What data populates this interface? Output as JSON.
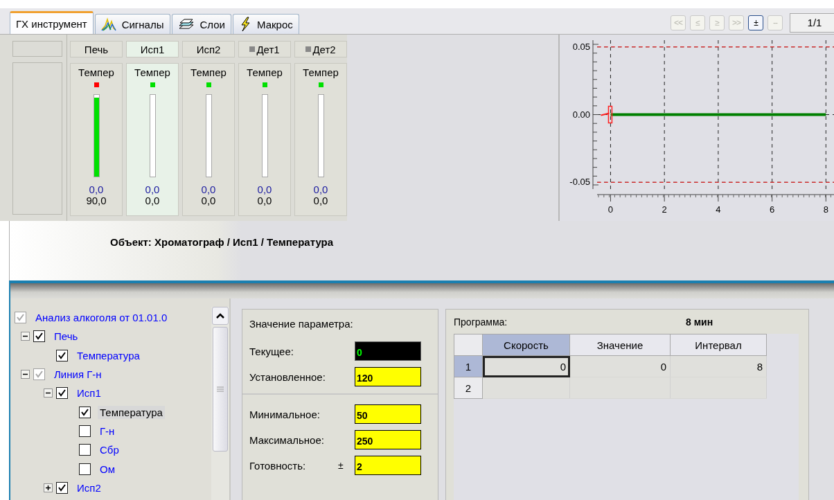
{
  "tabs": [
    {
      "label": "ГХ инструмент",
      "kind": "plain",
      "selected": true
    },
    {
      "label": "Сигналы",
      "kind": "signals",
      "selected": false
    },
    {
      "label": "Слои",
      "kind": "layers",
      "selected": false
    },
    {
      "label": "Макрос",
      "kind": "macro",
      "selected": false
    }
  ],
  "nav_buttons": [
    {
      "label": "<<",
      "disabled": true
    },
    {
      "label": "≤",
      "disabled": true
    },
    {
      "label": "≥",
      "disabled": true
    },
    {
      "label": ">>",
      "disabled": true
    },
    {
      "label": "±",
      "disabled": false
    },
    {
      "label": "--",
      "disabled": true
    }
  ],
  "page_indicator": "1/1",
  "channels": [
    {
      "name": "Печь",
      "marker": false,
      "selected": false,
      "parameter": "Темпер",
      "color": "#ff0000",
      "level": 0.97,
      "reading": "0,0",
      "setpoint": "90,0"
    },
    {
      "name": "Исп1",
      "marker": false,
      "selected": true,
      "parameter": "Темпер",
      "color": "#00e000",
      "level": 0,
      "reading": "0,0",
      "setpoint": "0,0"
    },
    {
      "name": "Исп2",
      "marker": false,
      "selected": false,
      "parameter": "Темпер",
      "color": "#00e000",
      "level": 0,
      "reading": "0,0",
      "setpoint": "0,0"
    },
    {
      "name": "Дет1",
      "marker": true,
      "selected": false,
      "parameter": "Темпер",
      "color": "#00e000",
      "level": 0,
      "reading": "0,0",
      "setpoint": "0,0"
    },
    {
      "name": "Дет2",
      "marker": true,
      "selected": false,
      "parameter": "Темпер",
      "color": "#00e000",
      "level": 0,
      "reading": "0,0",
      "setpoint": "0,0"
    }
  ],
  "chart": {
    "chart_data": {
      "type": "line",
      "grid": true,
      "x": [
        0,
        8
      ],
      "series": [
        {
          "color": "#008000",
          "values": [
            0,
            0
          ]
        }
      ],
      "xlim": [
        -0.5,
        8.3
      ],
      "ylim": [
        -0.055,
        0.055
      ],
      "xticks": [
        0,
        2,
        4,
        6,
        8
      ],
      "yticks": [
        {
          "value": 0.05,
          "label": "0.05"
        },
        {
          "value": 0,
          "label": "0.00"
        },
        {
          "value": -0.05,
          "label": "-0.05"
        }
      ]
    }
  },
  "object_path": "Объект: Хроматограф / Исп1 / Температура",
  "tree": [
    {
      "label": "Анализ алкоголя от 01.01.0",
      "checked": true,
      "grayed": true,
      "selected": false,
      "children": [
        {
          "label": "Печь",
          "checked": true,
          "grayed": false,
          "selected": false,
          "expanded": true,
          "children": [
            {
              "label": "Температура",
              "checked": true,
              "grayed": false,
              "selected": false
            }
          ]
        },
        {
          "label": "Линия Г-н",
          "checked": true,
          "grayed": true,
          "selected": false,
          "expanded": true,
          "children": [
            {
              "label": "Исп1",
              "checked": true,
              "grayed": false,
              "selected": false,
              "expanded": true,
              "children": [
                {
                  "label": "Температура",
                  "checked": true,
                  "grayed": false,
                  "selected": true
                },
                {
                  "label": "Г-н",
                  "checked": false,
                  "grayed": false,
                  "selected": false
                },
                {
                  "label": "Сбр",
                  "checked": false,
                  "grayed": false,
                  "selected": false
                },
                {
                  "label": "Ом",
                  "checked": false,
                  "grayed": false,
                  "selected": false
                }
              ]
            },
            {
              "label": "Исп2",
              "checked": true,
              "grayed": false,
              "selected": false,
              "expanded": false
            }
          ]
        }
      ]
    }
  ],
  "parameter": {
    "title": "Значение параметра:",
    "groups": [
      [
        {
          "label": "Текущее:",
          "kind": "readout",
          "value": "0"
        },
        {
          "label": "Установленное:",
          "kind": "input",
          "value": "120"
        }
      ],
      [
        {
          "label": "Минимальное:",
          "kind": "input",
          "value": "50"
        },
        {
          "label": "Максимальное:",
          "kind": "input",
          "value": "250"
        },
        {
          "label": "Готовность:",
          "prefix": "±",
          "kind": "input",
          "value": "2"
        }
      ]
    ]
  },
  "program": {
    "title": "Программа:",
    "duration": "8 мин",
    "columns": [
      {
        "label": "Скорость",
        "selected": true
      },
      {
        "label": "Значение",
        "selected": false
      },
      {
        "label": "Интервал",
        "selected": false
      }
    ],
    "rows": [
      {
        "label": "1",
        "selected": true,
        "cells": [
          {
            "text": "0",
            "focused": true
          },
          {
            "text": "0",
            "focused": false
          },
          {
            "text": "8",
            "focused": false
          }
        ]
      },
      {
        "label": "2",
        "selected": false
      }
    ]
  }
}
